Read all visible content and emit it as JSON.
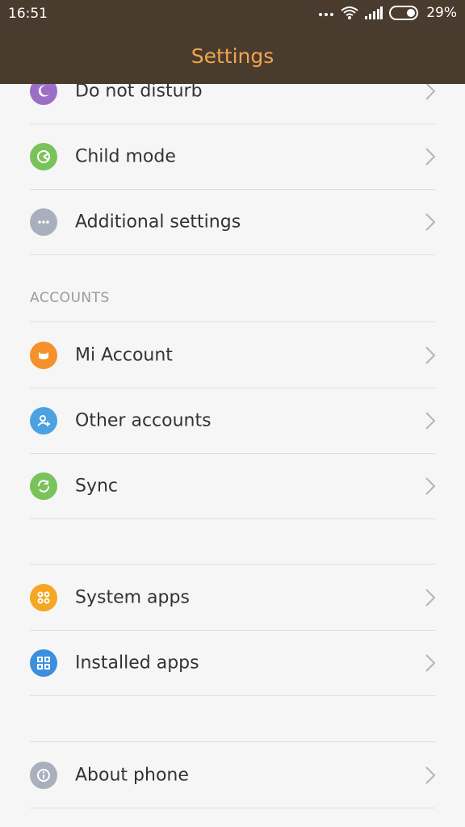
{
  "status_bar": {
    "time": "16:51",
    "battery_percent": "29%"
  },
  "app_bar": {
    "title": "Settings"
  },
  "rows_top": [
    {
      "label": "Do not disturb",
      "icon": "moon-icon",
      "color": "#9b6fc6"
    },
    {
      "label": "Child mode",
      "icon": "child-mode-icon",
      "color": "#79c35a"
    },
    {
      "label": "Additional settings",
      "icon": "more-dots-icon",
      "color": "#a9b0bd"
    }
  ],
  "accounts": {
    "header": "ACCOUNTS",
    "rows": [
      {
        "label": "Mi Account",
        "icon": "mi-account-icon",
        "color": "#f5902a"
      },
      {
        "label": "Other accounts",
        "icon": "add-person-icon",
        "color": "#4aa3e0"
      },
      {
        "label": "Sync",
        "icon": "sync-icon",
        "color": "#79c35a"
      }
    ]
  },
  "apps": {
    "rows": [
      {
        "label": "System apps",
        "icon": "system-apps-icon",
        "color": "#f5a623"
      },
      {
        "label": "Installed apps",
        "icon": "installed-apps-icon",
        "color": "#3b8fe0"
      }
    ]
  },
  "about": {
    "rows": [
      {
        "label": "About phone",
        "icon": "info-icon",
        "color": "#a9b0bd"
      }
    ]
  }
}
